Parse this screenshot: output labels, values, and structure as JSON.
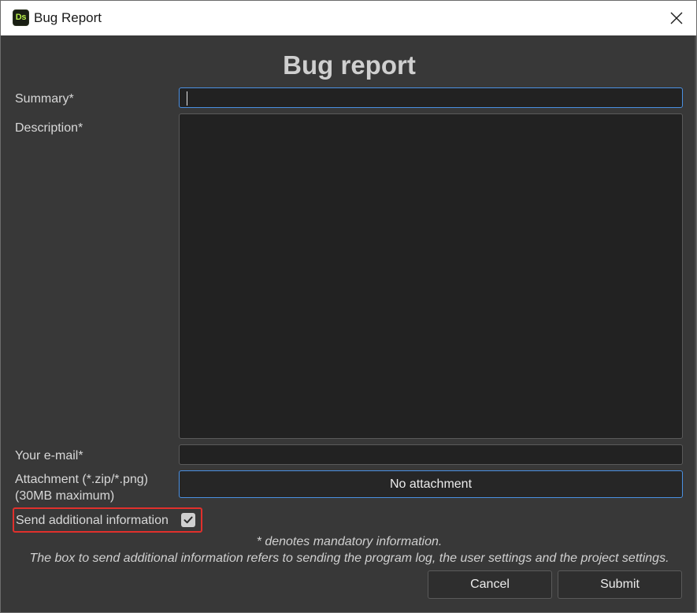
{
  "window": {
    "app_icon_text": "Ds",
    "title": "Bug Report"
  },
  "form": {
    "heading": "Bug report",
    "summary": {
      "label": "Summary*",
      "value": ""
    },
    "description": {
      "label": "Description*",
      "value": ""
    },
    "email": {
      "label": "Your e-mail*",
      "value": ""
    },
    "attachment": {
      "label_line1": "Attachment (*.zip/*.png)",
      "label_line2": "(30MB maximum)",
      "button_label": "No attachment"
    },
    "send_info": {
      "label": "Send additional information",
      "checked": true
    },
    "mandatory_note": "* denotes mandatory information.",
    "info_note": "The box to send additional information refers to sending the program log, the user settings and the project settings."
  },
  "buttons": {
    "cancel": "Cancel",
    "submit": "Submit"
  },
  "colors": {
    "background": "#383838",
    "input_bg": "#222222",
    "focus_border": "#4a90e2",
    "highlight_border": "#e0302c",
    "app_icon_fg": "#b8f04a"
  },
  "icons": {
    "close": "close-icon",
    "checkbox": "checkmark-icon"
  }
}
